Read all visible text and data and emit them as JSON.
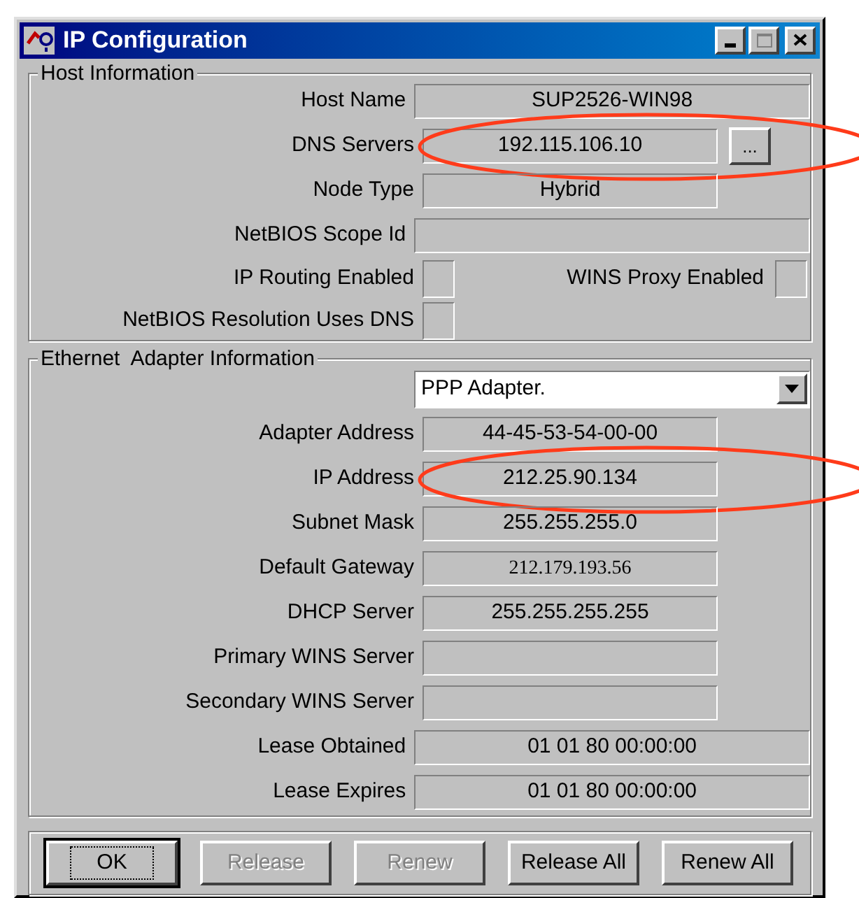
{
  "window": {
    "title": "IP Configuration"
  },
  "host_information": {
    "title": "Host Information",
    "fields": [
      {
        "label": "Host Name",
        "value": "SUP2526-WIN98",
        "kind": "wide"
      },
      {
        "label": "DNS Servers",
        "value": "192.115.106.10",
        "kind": "more",
        "button": "...",
        "highlighted": true
      },
      {
        "label": "Node Type",
        "value": "Hybrid",
        "kind": "narrow"
      },
      {
        "label": "NetBIOS Scope Id",
        "kind": "wide"
      }
    ],
    "checks": [
      {
        "label": "IP Routing Enabled",
        "checked": false
      },
      {
        "label": "WINS Proxy Enabled",
        "checked": false
      },
      {
        "label": "NetBIOS Resolution Uses DNS",
        "checked": false
      }
    ]
  },
  "adapter_information": {
    "title": "Ethernet  Adapter Information",
    "adapter": "PPP Adapter.",
    "fields": [
      {
        "label": "Adapter Address",
        "value": "44-45-53-54-00-00",
        "kind": "narrow"
      },
      {
        "label": "IP Address",
        "value": "212.25.90.134",
        "kind": "narrow",
        "highlighted": true
      },
      {
        "label": "Subnet Mask",
        "value": "255.255.255.0",
        "kind": "narrow"
      },
      {
        "label": "Default Gateway",
        "value": "212.179.193.56",
        "kind": "serif"
      },
      {
        "label": "DHCP Server",
        "value": "255.255.255.255",
        "kind": "narrow"
      },
      {
        "label": "Primary WINS Server",
        "kind": "narrow"
      },
      {
        "label": "Secondary WINS Server",
        "kind": "narrow"
      },
      {
        "label": "Lease Obtained",
        "value": "01 01 80 00:00:00",
        "kind": "wide"
      },
      {
        "label": "Lease Expires",
        "value": "01 01 80 00:00:00",
        "kind": "wide"
      }
    ]
  },
  "buttons": [
    {
      "label": "OK",
      "disabled": false,
      "default": true
    },
    {
      "label": "Release",
      "disabled": true,
      "default": false
    },
    {
      "label": "Renew",
      "disabled": true,
      "default": false
    },
    {
      "label": "Release All",
      "disabled": false,
      "default": false
    },
    {
      "label": "Renew All",
      "disabled": false,
      "default": false
    }
  ]
}
